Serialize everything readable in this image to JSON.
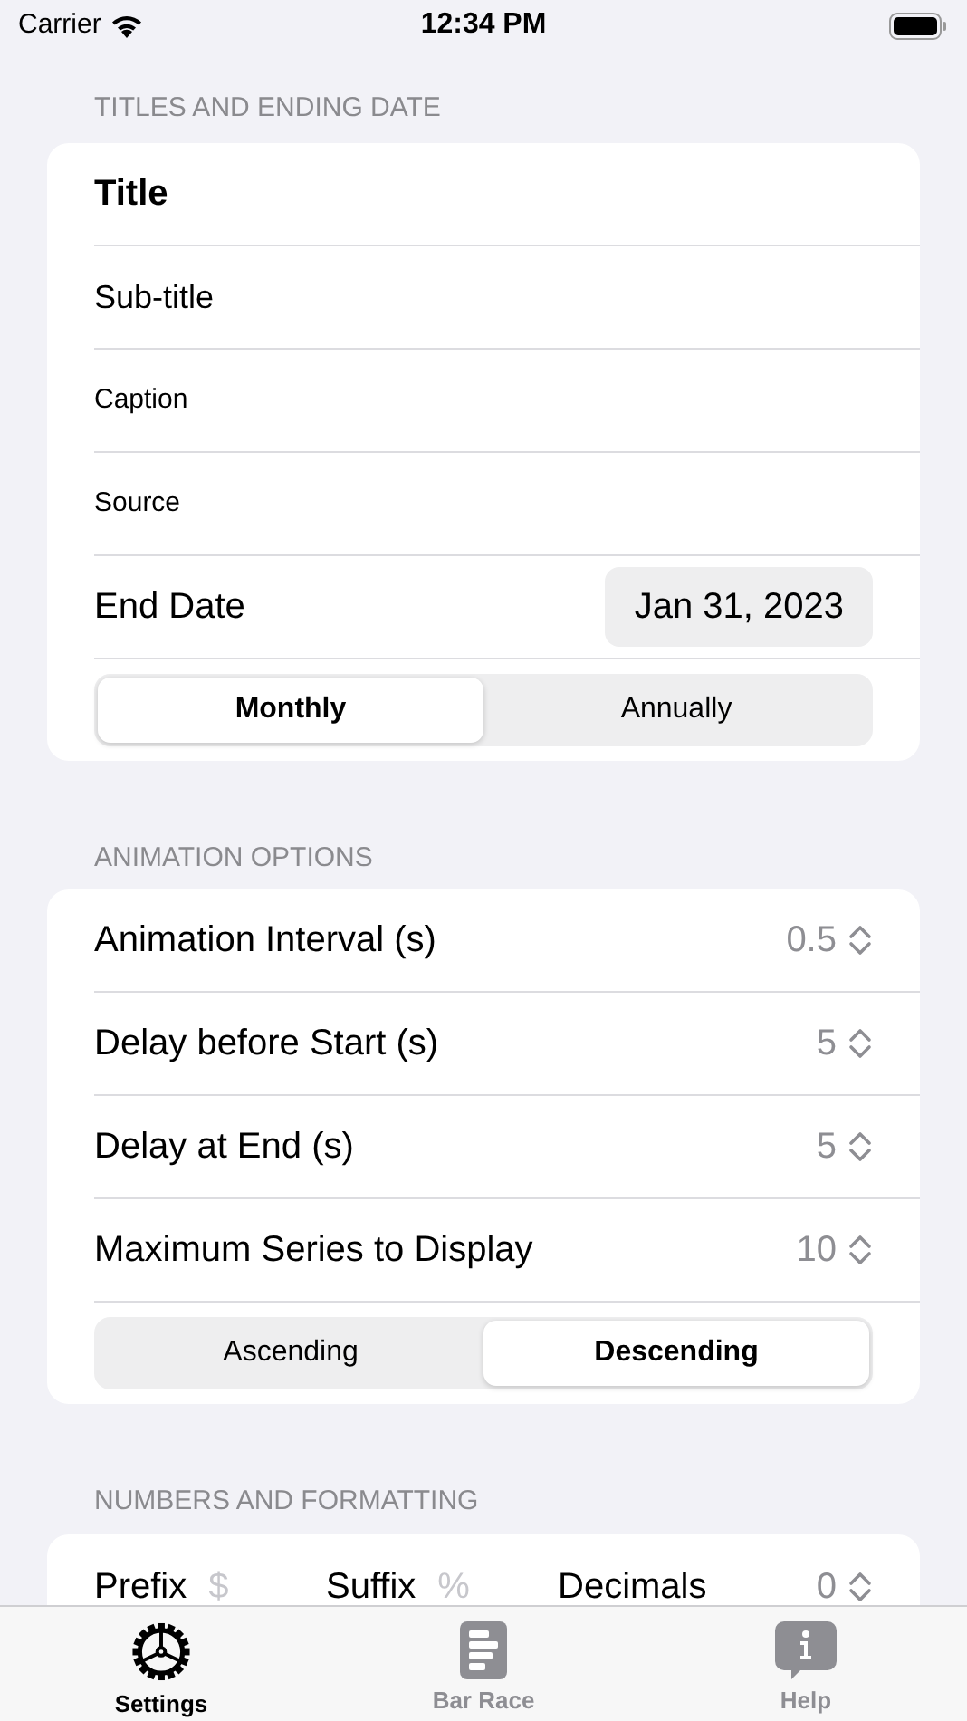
{
  "status_bar": {
    "carrier": "Carrier",
    "time": "12:34 PM"
  },
  "titles_section": {
    "header": "TITLES AND ENDING DATE",
    "fields": [
      {
        "kind": "title",
        "value": "Title"
      },
      {
        "kind": "subtitle",
        "value": "Sub-title"
      },
      {
        "kind": "body",
        "value": "Caption"
      },
      {
        "kind": "body",
        "value": "Source"
      }
    ],
    "end_date": {
      "label": "End Date",
      "value": "Jan 31, 2023"
    },
    "period": [
      {
        "label": "Monthly",
        "selected": true
      },
      {
        "label": "Annually",
        "selected": false
      }
    ]
  },
  "animation_section": {
    "header": "ANIMATION OPTIONS",
    "steppers": [
      {
        "label": "Animation Interval (s)",
        "value": "0.5"
      },
      {
        "label": "Delay before Start (s)",
        "value": "5"
      },
      {
        "label": "Delay at End (s)",
        "value": "5"
      },
      {
        "label": "Maximum Series to Display",
        "value": "10"
      }
    ],
    "order": [
      {
        "label": "Ascending",
        "selected": false
      },
      {
        "label": "Descending",
        "selected": true
      }
    ]
  },
  "numbers_section": {
    "header": "NUMBERS AND FORMATTING",
    "items": [
      {
        "kind": "text",
        "label": "Prefix",
        "placeholder": "$"
      },
      {
        "kind": "text",
        "label": "Suffix",
        "placeholder": "%"
      },
      {
        "kind": "stepper",
        "label": "Decimals",
        "value": "0"
      }
    ]
  },
  "tab_bar": [
    {
      "kind": "gear",
      "label": "Settings",
      "selected": true
    },
    {
      "kind": "bars",
      "label": "Bar Race",
      "selected": false
    },
    {
      "kind": "info",
      "label": "Help",
      "selected": false
    }
  ]
}
